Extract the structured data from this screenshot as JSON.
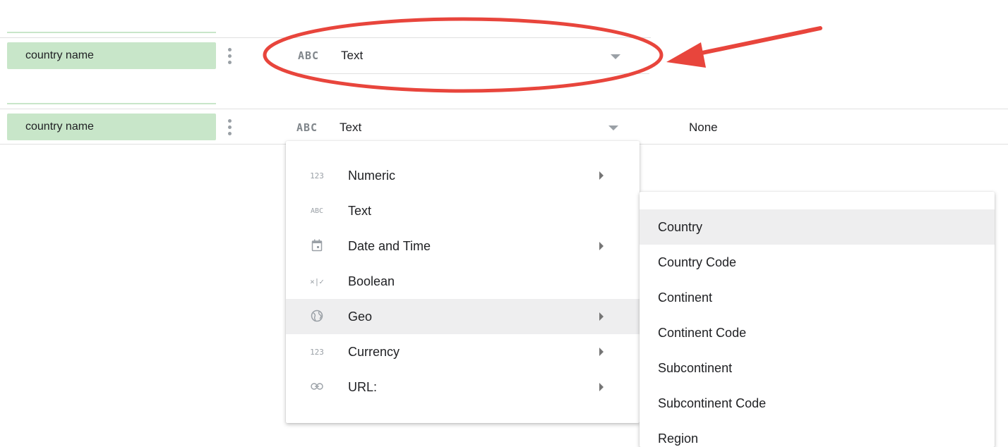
{
  "rows": [
    {
      "field_name": "country name",
      "type_icon": "ABC",
      "type_label": "Text",
      "aggregation": ""
    },
    {
      "field_name": "country name",
      "type_icon": "ABC",
      "type_label": "Text",
      "aggregation": "None"
    }
  ],
  "type_menu": {
    "items": [
      {
        "icon": "123",
        "icon_name": "numeric-icon",
        "label": "Numeric",
        "has_submenu": true,
        "highlighted": false
      },
      {
        "icon": "ABC",
        "icon_name": "text-icon",
        "label": "Text",
        "has_submenu": false,
        "highlighted": false
      },
      {
        "icon": "calendar",
        "icon_name": "calendar-icon",
        "label": "Date and Time",
        "has_submenu": true,
        "highlighted": false
      },
      {
        "icon": "×|✓",
        "icon_name": "boolean-icon",
        "label": "Boolean",
        "has_submenu": false,
        "highlighted": false
      },
      {
        "icon": "globe",
        "icon_name": "globe-icon",
        "label": "Geo",
        "has_submenu": true,
        "highlighted": true
      },
      {
        "icon": "123",
        "icon_name": "currency-icon",
        "label": "Currency",
        "has_submenu": true,
        "highlighted": false
      },
      {
        "icon": "link",
        "icon_name": "link-icon",
        "label": "URL:",
        "has_submenu": true,
        "highlighted": false
      }
    ]
  },
  "geo_submenu": {
    "items": [
      {
        "label": "Country",
        "highlighted": true
      },
      {
        "label": "Country Code",
        "highlighted": false
      },
      {
        "label": "Continent",
        "highlighted": false
      },
      {
        "label": "Continent Code",
        "highlighted": false
      },
      {
        "label": "Subcontinent",
        "highlighted": false
      },
      {
        "label": "Subcontinent Code",
        "highlighted": false
      },
      {
        "label": "Region",
        "highlighted": false
      }
    ]
  },
  "annotation": {
    "color": "#e8453c",
    "shape": "ellipse-with-arrow"
  },
  "colors": {
    "field_chip": "#c8e6c9",
    "highlight": "#eeeeef",
    "annotation": "#e8453c"
  }
}
